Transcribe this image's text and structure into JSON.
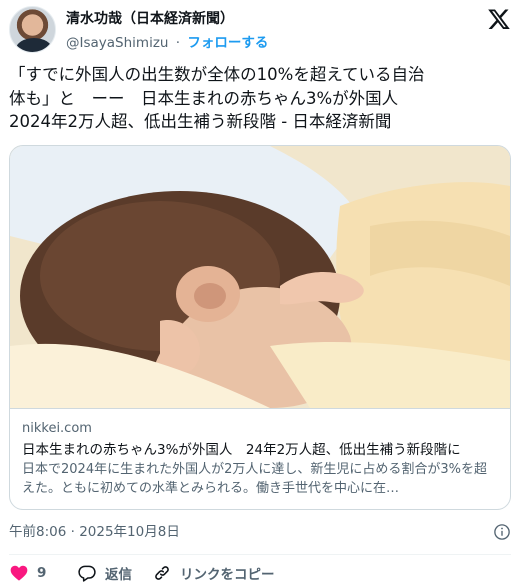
{
  "author": {
    "name": "清水功哉（日本経済新聞）",
    "handle": "@IsayaShimizu",
    "separator": "·",
    "follow_label": "フォローする"
  },
  "tweet": {
    "text": "「すでに外国人の出生数が全体の10%を超えている自治\n体も」と　ーー　日本生まれの赤ちゃん3%が外国人\n2024年2万人超、低出生補う新段階 - 日本経済新聞"
  },
  "card": {
    "domain": "nikkei.com",
    "title": "日本生まれの赤ちゃん3%が外国人　24年2万人超、低出生補う新段階に",
    "description": "日本で2024年に生まれた外国人が2万人に達し、新生児に占める割合が3%を超えた。ともに初めての水準とみられる。働き手世代を中心に在…"
  },
  "timestamp": "午前8:06 · 2025年10月8日",
  "actions": {
    "likes": "9",
    "reply_label": "返信",
    "copy_label": "リンクをコピー"
  },
  "colors": {
    "accent": "#1d9bf0",
    "like": "#f91880",
    "secondary_text": "#536471"
  },
  "icons": [
    "x-logo-icon",
    "info-icon",
    "heart-icon",
    "reply-icon",
    "link-icon"
  ]
}
